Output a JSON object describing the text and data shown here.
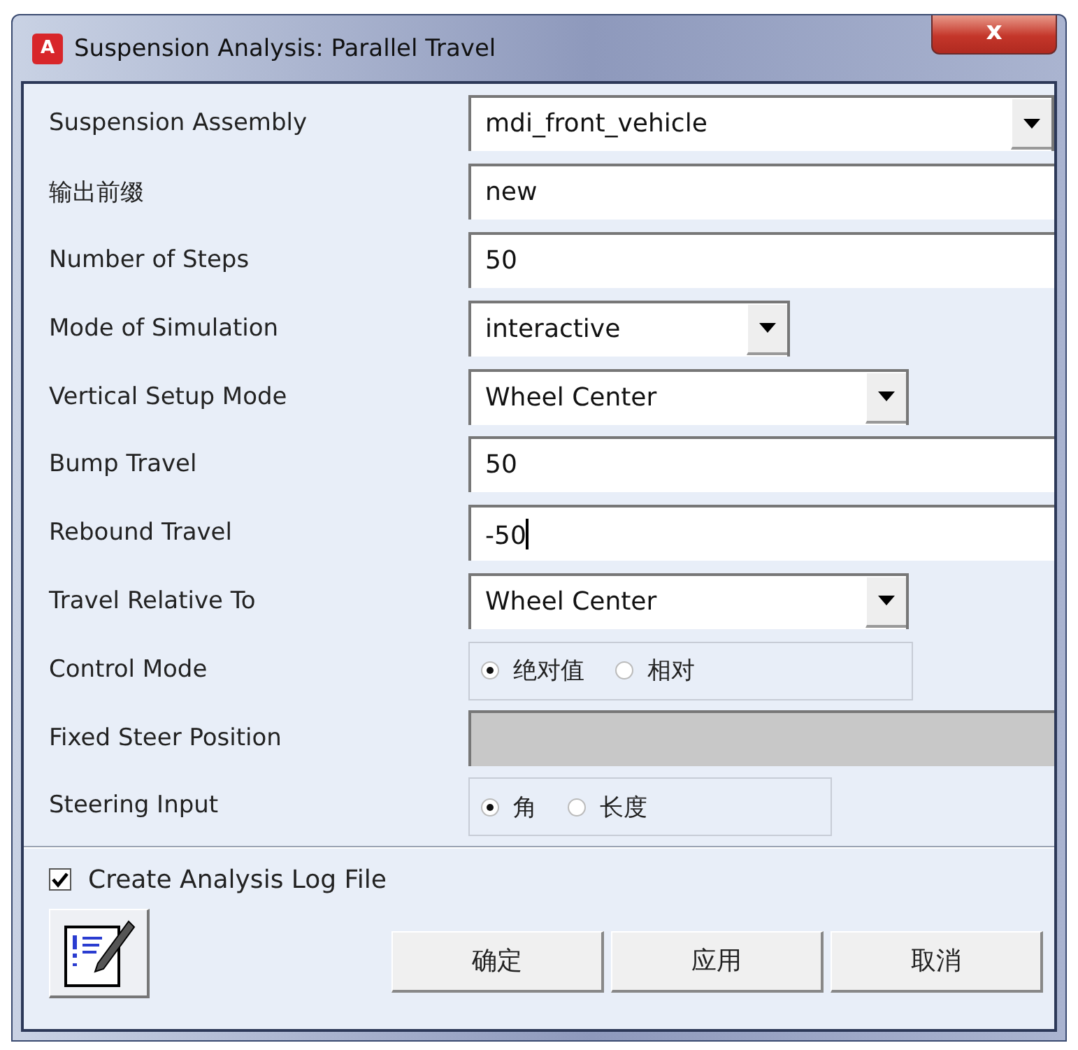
{
  "window": {
    "title": "Suspension Analysis: Parallel Travel",
    "app_icon": "A",
    "close": "x"
  },
  "fields": [
    {
      "label": "Suspension Assembly",
      "kind": "dropdown",
      "value": "mdi_front_vehicle"
    },
    {
      "label": "输出前缀",
      "kind": "text",
      "value": "new"
    },
    {
      "label": "Number of Steps",
      "kind": "text",
      "value": "50"
    },
    {
      "label": "Mode of Simulation",
      "kind": "dropdown-short",
      "value": "interactive"
    },
    {
      "label": "Vertical Setup Mode",
      "kind": "dropdown-medium",
      "value": "Wheel Center"
    },
    {
      "label": "Bump Travel",
      "kind": "text",
      "value": "50"
    },
    {
      "label": "Rebound Travel",
      "kind": "text",
      "value": "-50",
      "focused": true
    },
    {
      "label": "Travel Relative To",
      "kind": "dropdown-medium",
      "value": "Wheel Center"
    },
    {
      "label": "Control Mode",
      "kind": "radio",
      "options": [
        {
          "label": "绝对值",
          "selected": true
        },
        {
          "label": "相对",
          "selected": false
        }
      ]
    },
    {
      "label": "Fixed Steer Position",
      "kind": "disabled"
    },
    {
      "label": "Steering Input",
      "kind": "radio-short",
      "options": [
        {
          "label": "角",
          "selected": true
        },
        {
          "label": "长度",
          "selected": false
        }
      ]
    }
  ],
  "log_file": {
    "label": "Create Analysis Log File",
    "checked": true
  },
  "buttons": [
    "确定",
    "应用",
    "取消"
  ]
}
